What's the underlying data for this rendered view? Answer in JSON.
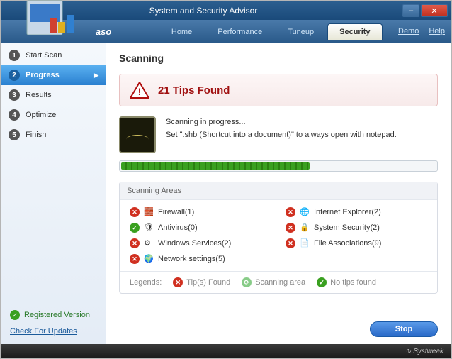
{
  "window": {
    "title": "System and Security Advisor"
  },
  "header": {
    "brand": "aso",
    "tabs": [
      {
        "label": "Home",
        "active": false
      },
      {
        "label": "Performance",
        "active": false
      },
      {
        "label": "Tuneup",
        "active": false
      },
      {
        "label": "Security",
        "active": true
      }
    ],
    "links": {
      "demo": "Demo",
      "help": "Help"
    }
  },
  "sidebar": {
    "steps": [
      {
        "num": "1",
        "label": "Start Scan",
        "active": false
      },
      {
        "num": "2",
        "label": "Progress",
        "active": true
      },
      {
        "num": "3",
        "label": "Results",
        "active": false
      },
      {
        "num": "4",
        "label": "Optimize",
        "active": false
      },
      {
        "num": "5",
        "label": "Finish",
        "active": false
      }
    ],
    "registered": "Registered Version",
    "check_updates": "Check For Updates"
  },
  "main": {
    "heading": "Scanning",
    "alert": "21 Tips Found",
    "scan_status": "Scanning in progress...",
    "scan_detail": "Set \".shb (Shortcut into a document)\" to always open with notepad.",
    "progress_pct": 60,
    "areas_header": "Scanning Areas",
    "areas": [
      {
        "status": "err",
        "icon": "firewall",
        "label": "Firewall(1)"
      },
      {
        "status": "err",
        "icon": "ie",
        "label": "Internet Explorer(2)"
      },
      {
        "status": "ok",
        "icon": "antivirus",
        "label": "Antivirus(0)"
      },
      {
        "status": "err",
        "icon": "lock",
        "label": "System Security(2)"
      },
      {
        "status": "err",
        "icon": "services",
        "label": "Windows Services(2)"
      },
      {
        "status": "err",
        "icon": "file",
        "label": "File Associations(9)"
      },
      {
        "status": "err",
        "icon": "network",
        "label": "Network settings(5)"
      }
    ],
    "legends": {
      "label": "Legends:",
      "tips": "Tip(s) Found",
      "scanning": "Scanning area",
      "none": "No tips found"
    },
    "stop": "Stop"
  },
  "footer": {
    "brand": "Systweak"
  }
}
